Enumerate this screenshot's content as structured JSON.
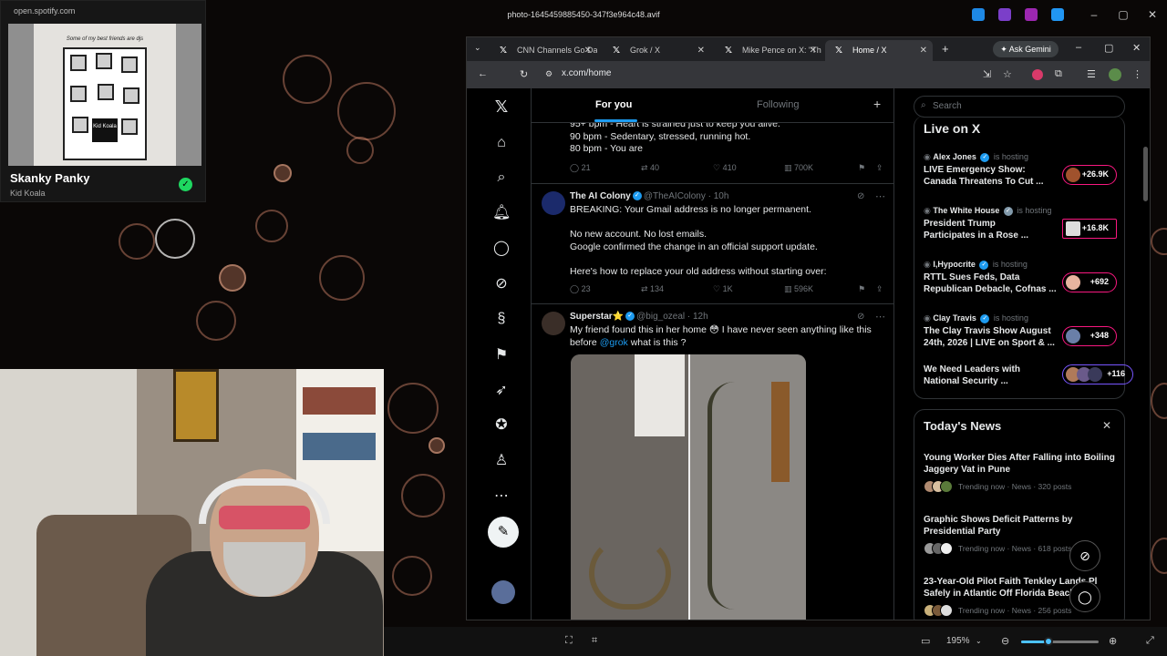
{
  "viewer": {
    "title": "photo-1645459885450-347f3e964c48.avif",
    "zoom": "195%",
    "zoom_level": 0.35
  },
  "spotify": {
    "url": "open.spotify.com",
    "art_caption": "Some of my best friends are djs",
    "art_sign": "Kid Koala",
    "track": "Skanky Panky",
    "artist": "Kid Koala"
  },
  "browser": {
    "tabs": [
      {
        "label": "CNN Channels Go Da",
        "active": false
      },
      {
        "label": "Grok / X",
        "active": false
      },
      {
        "label": "Mike Pence on X: \"Th",
        "active": false
      },
      {
        "label": "Home / X",
        "active": true
      }
    ],
    "ask_gemini": "Ask Gemini",
    "url": "x.com/home"
  },
  "x": {
    "tabs": {
      "for_you": "For you",
      "following": "Following"
    },
    "tweet1": {
      "lines": [
        "95+ bpm - Heart is strained just to keep you alive.",
        "90 bpm - Sedentary, stressed, running hot.",
        "80 bpm - You are"
      ],
      "replies": "21",
      "reposts": "40",
      "likes": "410",
      "views": "700K"
    },
    "tweet2": {
      "name": "The AI Colony",
      "handle": "@TheAIColony",
      "time": "· 10h",
      "lines": [
        "BREAKING: Your Gmail address is no longer permanent.",
        "",
        "No new account. No lost emails.",
        "Google confirmed the change in an official support update.",
        "",
        "Here's how to replace your old address without starting over:"
      ],
      "replies": "23",
      "reposts": "134",
      "likes": "1K",
      "views": "596K"
    },
    "tweet3": {
      "name": "Superstar⭐",
      "handle": "@big_ozeal",
      "time": "· 12h",
      "line1": "My friend found this in her home 😳 I have never seen anything like this",
      "line2_pre": "before ",
      "mention": "@grok",
      "line2_post": " what is this ?"
    },
    "search_placeholder": "Search",
    "live": {
      "title": "Live on X",
      "hosting": "is hosting",
      "items": [
        {
          "host": "Alex Jones",
          "title1": "LIVE Emergency Show:",
          "title2": "Canada Threatens To Cut ...",
          "count": "+26.9K"
        },
        {
          "host": "The White House",
          "title1": "President Trump",
          "title2": "Participates in a Rose ...",
          "count": "+16.8K"
        },
        {
          "host": "I,Hypocrite",
          "title1": "RTTL Sues Feds, Data",
          "title2": "Republican Debacle, Cofnas ...",
          "count": "+692"
        },
        {
          "host": "Clay Travis",
          "title1": "The Clay Travis Show August",
          "title2": "24th, 2026 | LIVE on Sport & ...",
          "count": "+348"
        },
        {
          "host": "",
          "title1": "We Need Leaders with",
          "title2": "National Security ...",
          "count": "+116"
        }
      ]
    },
    "news": {
      "title": "Today's News",
      "items": [
        {
          "line1": "Young Worker Dies After Falling into Boiling",
          "line2": "Jaggery Vat in Pune",
          "meta": "Trending now · News · 320 posts"
        },
        {
          "line1": "Graphic Shows Deficit Patterns by",
          "line2": "Presidential Party",
          "meta": "Trending now · News · 618 posts"
        },
        {
          "line1": "23-Year-Old Pilot Faith Tenkley Lands Pl",
          "line2": "Safely in Atlantic Off Florida Beach",
          "meta": "Trending now · News · 256 posts"
        }
      ]
    }
  },
  "colors": {
    "accent": "#1d9bf0",
    "live": "#f91880",
    "live_alt": "#7856ff",
    "spotify": "#1ed760"
  },
  "icons": [
    "x-logo-icon",
    "home-icon",
    "search-icon",
    "bell-icon",
    "message-icon",
    "grok-icon",
    "premium-icon",
    "bookmark-icon",
    "rocket-icon",
    "verified-orgs-icon",
    "profile-icon",
    "more-icon",
    "compose-icon"
  ]
}
